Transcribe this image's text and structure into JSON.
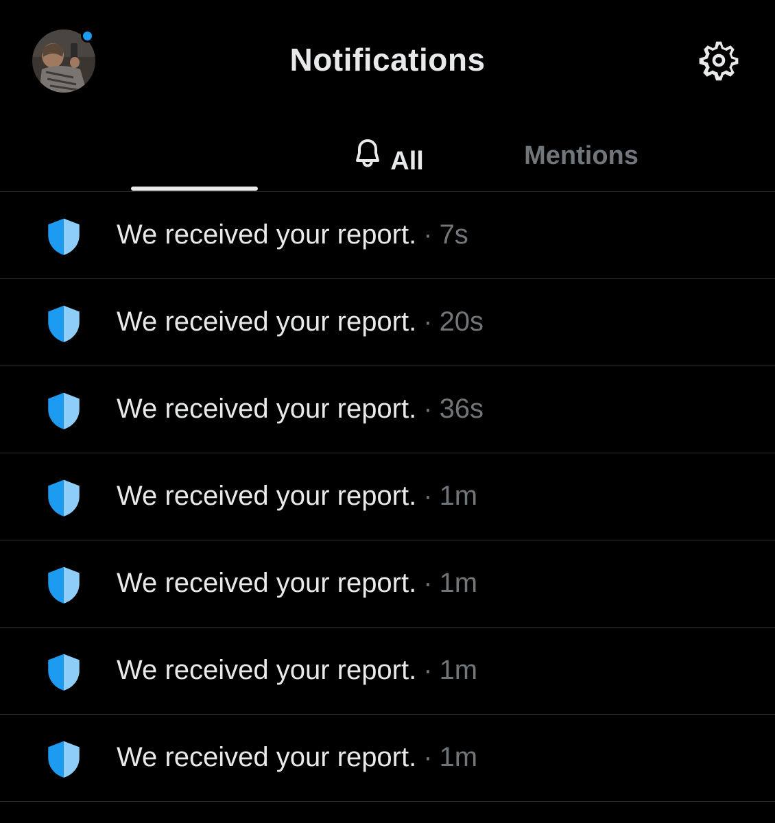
{
  "header": {
    "title": "Notifications",
    "avatar_icon": "avatar-photo",
    "settings_icon": "gear-icon",
    "accent_color": "#1d9bf0"
  },
  "tabs": [
    {
      "label": "All",
      "icon": "bell-icon",
      "active": true
    },
    {
      "label": "Mentions",
      "active": false
    }
  ],
  "notifications": [
    {
      "icon": "shield-icon",
      "text": "We received your report.",
      "separator": "·",
      "time": "7s"
    },
    {
      "icon": "shield-icon",
      "text": "We received your report.",
      "separator": "·",
      "time": "20s"
    },
    {
      "icon": "shield-icon",
      "text": "We received your report.",
      "separator": "·",
      "time": "36s"
    },
    {
      "icon": "shield-icon",
      "text": "We received your report.",
      "separator": "·",
      "time": "1m"
    },
    {
      "icon": "shield-icon",
      "text": "We received your report.",
      "separator": "·",
      "time": "1m"
    },
    {
      "icon": "shield-icon",
      "text": "We received your report.",
      "separator": "·",
      "time": "1m"
    },
    {
      "icon": "shield-icon",
      "text": "We received your report.",
      "separator": "·",
      "time": "1m"
    }
  ]
}
